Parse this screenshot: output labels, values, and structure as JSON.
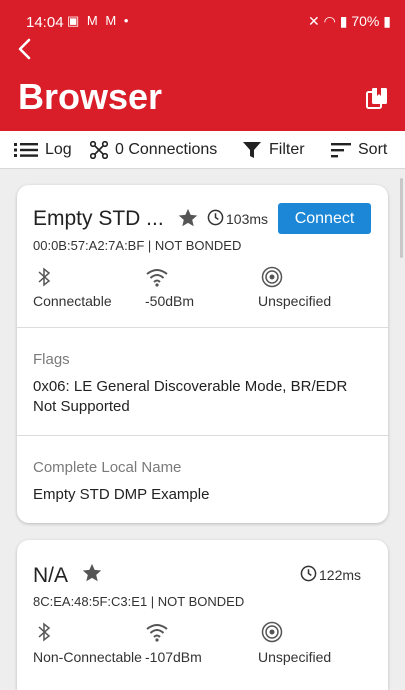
{
  "status_bar": {
    "time": "14:04",
    "left_icons": [
      "image-icon",
      "mail-icon",
      "mail-icon",
      "dot-icon"
    ],
    "battery": "70%"
  },
  "header": {
    "title": "Browser"
  },
  "toolbar": {
    "log_label": "Log",
    "connections_label": "0 Connections",
    "filter_label": "Filter",
    "sort_label": "Sort"
  },
  "devices": [
    {
      "name": "Empty STD ...",
      "favorite": true,
      "interval": "103ms",
      "connect_label": "Connect",
      "address": "00:0B:57:A2:7A:BF | NOT BONDED",
      "connectability": "Connectable",
      "rssi": "-50dBm",
      "tx_power": "Unspecified",
      "sections": [
        {
          "label": "Flags",
          "value": "0x06: LE General Discoverable Mode, BR/EDR Not Supported"
        },
        {
          "label": "Complete Local Name",
          "value": "Empty STD DMP Example"
        }
      ]
    },
    {
      "name": "N/A",
      "favorite": true,
      "interval": "122ms",
      "address": "8C:EA:48:5F:C3:E1 | NOT BONDED",
      "connectability": "Non-Connectable",
      "rssi": "-107dBm",
      "tx_power": "Unspecified"
    }
  ],
  "colors": {
    "appbar": "#d91e2a",
    "connect_button": "#1b87d6",
    "background": "#eeeeee"
  }
}
